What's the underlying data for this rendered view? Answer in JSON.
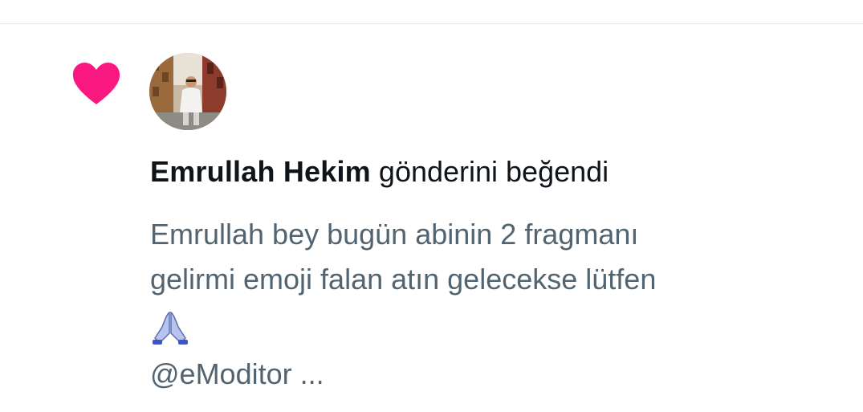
{
  "notification": {
    "type_icon": "heart-icon",
    "heart_color": "#f91880",
    "avatar_icon": "user-avatar",
    "user_name": "Emrullah Hekim",
    "action_text": "gönderini beğendi",
    "tweet_lines": [
      "Emrullah bey bugün abinin 2 fragmanı",
      "gelirmi emoji falan atın gelecekse lütfen"
    ],
    "emoji_icon": "folded-hands-icon",
    "handle_text": "@eModitor ..."
  },
  "colors": {
    "primary_text": "#0f1419",
    "secondary_text": "#536471",
    "divider": "#e6e9ec"
  }
}
